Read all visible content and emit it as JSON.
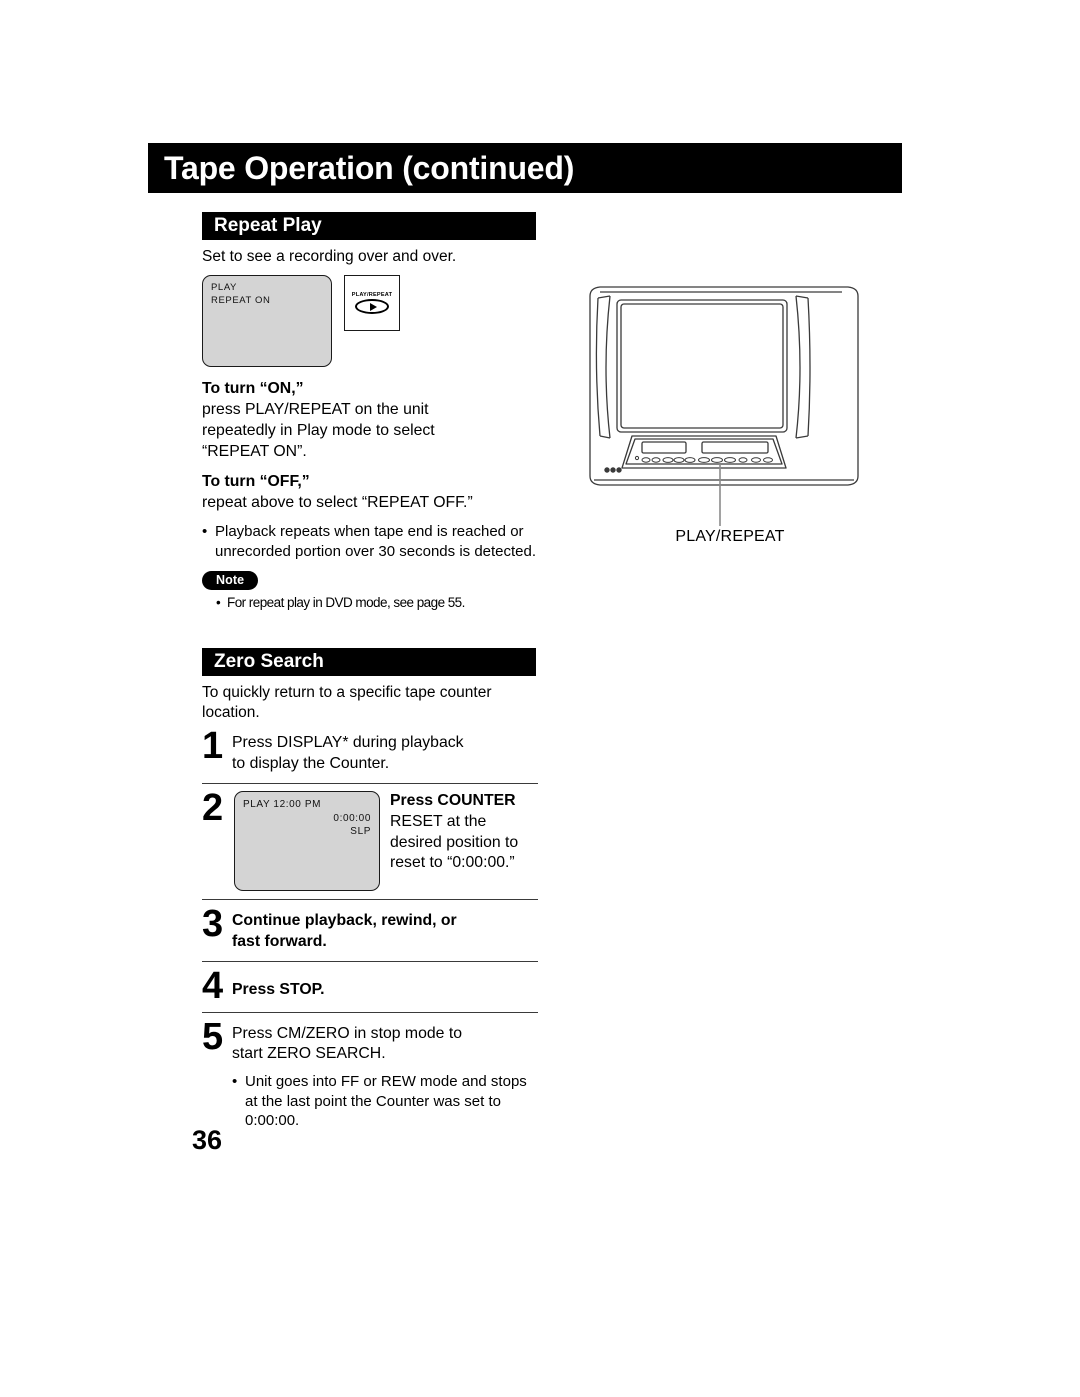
{
  "header": {
    "title": "Tape Operation (continued)"
  },
  "repeat_play": {
    "section_title": "Repeat Play",
    "intro": "Set to see a recording over and over.",
    "osd": {
      "line1": "PLAY",
      "line2": "REPEAT ON"
    },
    "button_detail": {
      "label": "PLAY/REPEAT",
      "icon": "play-oval-icon"
    },
    "on_heading": "To turn “ON,”",
    "on_text_bold": "press PLAY/REPEAT",
    "on_text_rest": " on the unit",
    "on_line2": "repeatedly in Play mode to select",
    "on_line3": "“REPEAT ON”.",
    "off_heading": "To turn “OFF,”",
    "off_text": "repeat above to select “REPEAT OFF.”",
    "bullet1": "Playback repeats when tape end is reached or unrecorded portion over 30 seconds is detected.",
    "note_badge": "Note",
    "note_bullet": "For repeat play in DVD mode, see page 55."
  },
  "zero_search": {
    "section_title": "Zero Search",
    "intro": "To quickly return to a specific tape counter location.",
    "steps": [
      {
        "num": "1",
        "bold": "Press DISPLAY*",
        "rest": " during playback",
        "line2": "to display the Counter."
      },
      {
        "num": "2",
        "osd": {
          "line1": "PLAY  12:00 PM",
          "counter": "0:00:00",
          "speed": "SLP"
        },
        "bold1": "Press COUNTER",
        "bold2": "RESET",
        "rest2": " at the",
        "line3": "desired position to",
        "line4": "reset to “0:00:00.”"
      },
      {
        "num": "3",
        "line1": "Continue playback, rewind, or",
        "line2": "fast forward."
      },
      {
        "num": "4",
        "line1": "Press STOP."
      },
      {
        "num": "5",
        "bold": "Press CM/ZERO",
        "rest": " in stop mode to",
        "line2": "start ZERO SEARCH.",
        "bullet": "Unit goes into FF or REW mode and stops at the last point the Counter was set to 0:00:00."
      }
    ]
  },
  "illustration": {
    "callout_label": "PLAY/REPEAT",
    "device": "tv-vcr-combo-front-view"
  },
  "page_number": "36",
  "colors": {
    "bar_black": "#000000",
    "osd_gray": "#d4d4d4",
    "rule": "#3a3a3a"
  }
}
